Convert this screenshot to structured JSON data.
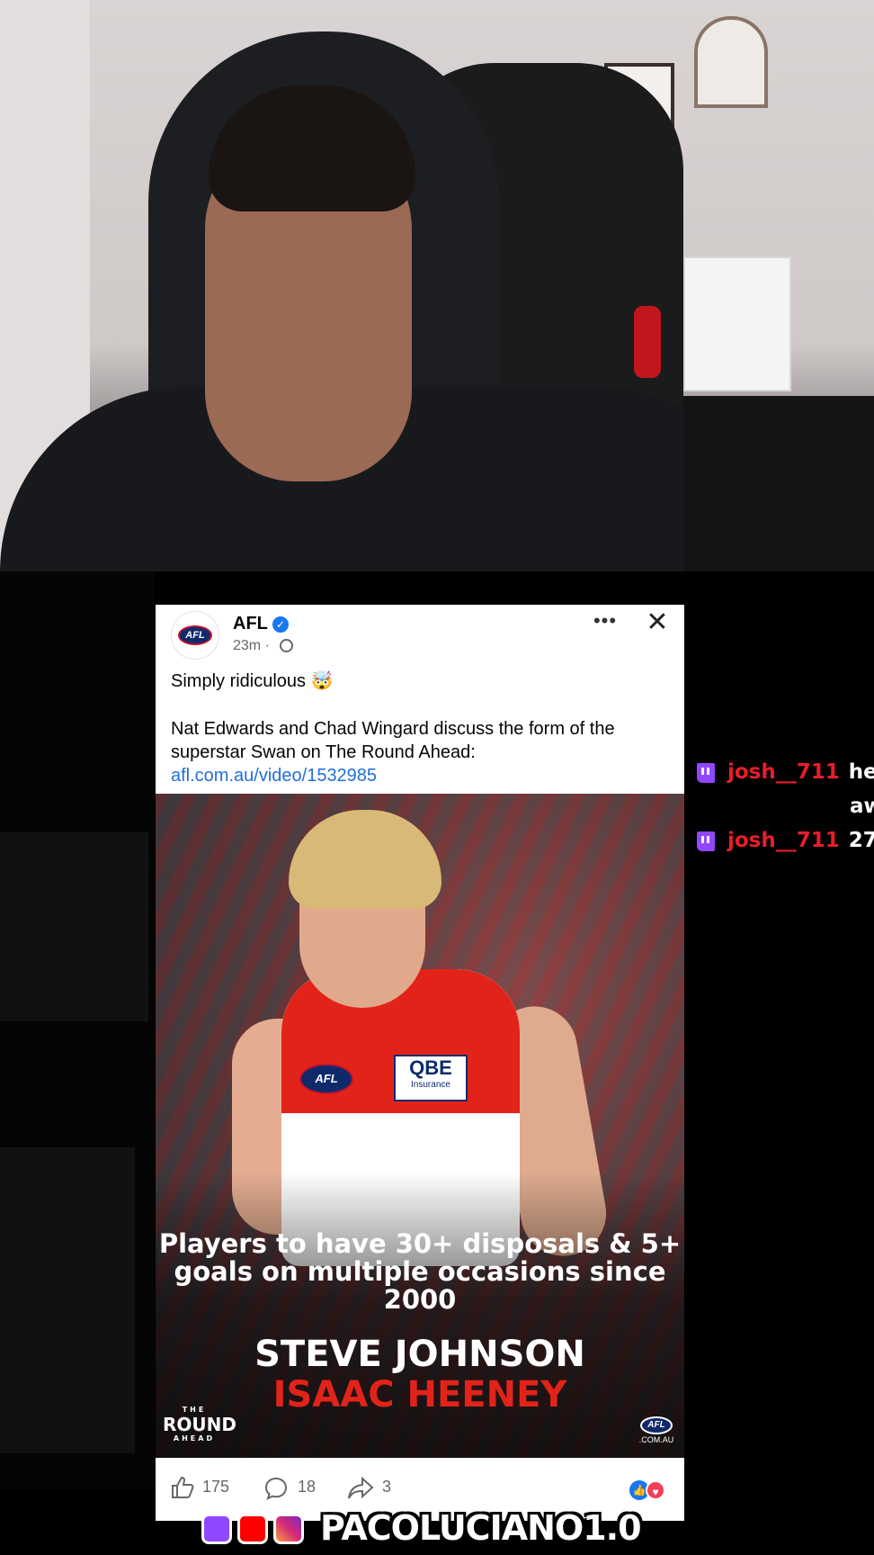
{
  "post": {
    "author": "AFL",
    "avatar_text": "AFL",
    "time": "23m ·",
    "more": "•••",
    "close": "✕",
    "caption_line1": "Simply ridiculous 🤯",
    "caption_body": "Nat Edwards and Chad Wingard discuss the form of the superstar Swan on The Round Ahead: ",
    "caption_link": "afl.com.au/video/1532985",
    "image": {
      "headline": "Players to have 30+ disposals & 5+ goals on multiple occasions since 2000",
      "name1": "STEVE JOHNSON",
      "name2": "ISAAC HEENEY",
      "sponsor": "QBE",
      "sponsor_sub": "Insurance",
      "chest_logo": "AFL",
      "corner_logo": "AFL",
      "corner_domain": ".COM.AU",
      "show_small": "THE",
      "show_big": "ROUND",
      "show_small2": "AHEAD"
    },
    "likes": "175",
    "comments": "18",
    "shares": "3"
  },
  "chat": [
    {
      "user": "josh__711",
      "message": "he"
    },
    {
      "user": "",
      "message": "aw"
    },
    {
      "user": "josh__711",
      "message": "27"
    }
  ],
  "footer": {
    "handle": "PACOLUCIANO1.0",
    "icons": [
      "twitch-icon",
      "youtube-icon",
      "instagram-icon"
    ]
  },
  "colors": {
    "facebook_blue": "#1877f2",
    "link": "#216fdb",
    "swans_red": "#e2231a",
    "twitch_purple": "#9146ff",
    "chat_username": "#e61e2a"
  }
}
